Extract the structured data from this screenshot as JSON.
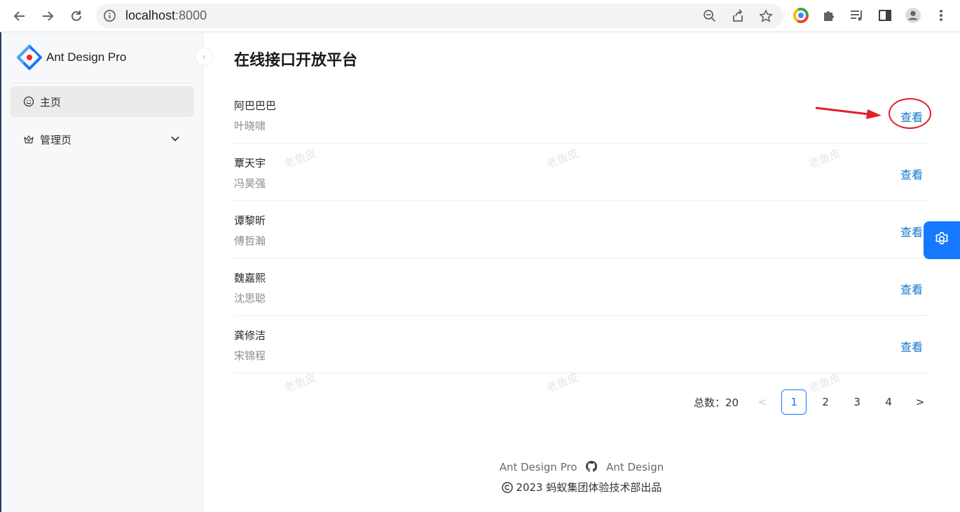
{
  "browser": {
    "url_host": "localhost",
    "url_port": ":8000"
  },
  "sidebar": {
    "brand": "Ant Design Pro",
    "items": [
      {
        "label": "主页",
        "icon": "smile-icon"
      },
      {
        "label": "管理页",
        "icon": "crown-icon"
      }
    ]
  },
  "page": {
    "title": "在线接口开放平台",
    "action_label": "查看",
    "list": [
      {
        "name": "阿巴巴巴",
        "desc": "叶晓啸"
      },
      {
        "name": "覃天宇",
        "desc": "冯昊强"
      },
      {
        "name": "谭黎昕",
        "desc": "傅哲瀚"
      },
      {
        "name": "魏嘉熙",
        "desc": "沈思聪"
      },
      {
        "name": "龚修洁",
        "desc": "宋锦程"
      }
    ],
    "watermark": "老鱼皮"
  },
  "pagination": {
    "total_label": "总数：20",
    "prev": "<",
    "pages": [
      "1",
      "2",
      "3",
      "4"
    ],
    "current": "1",
    "next": ">"
  },
  "footer": {
    "link1": "Ant Design Pro",
    "link2": "Ant Design",
    "copyright": "2023 蚂蚁集团体验技术部出品"
  },
  "colors": {
    "primary": "#1677ff",
    "link": "#1677c9",
    "annotation": "#e0202a"
  }
}
